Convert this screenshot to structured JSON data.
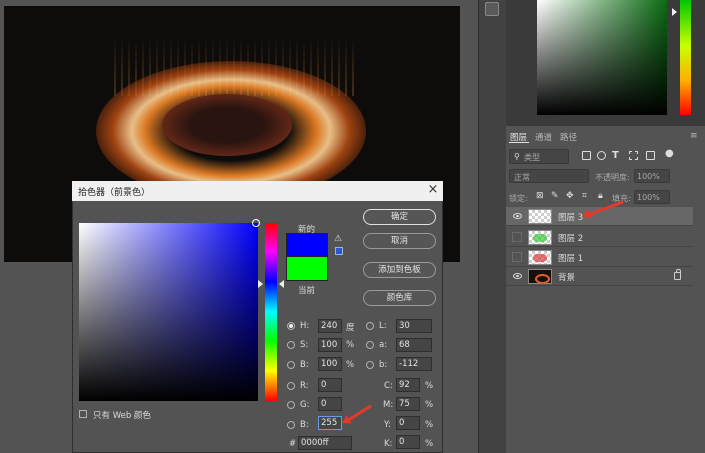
{
  "dialog": {
    "title": "拾色器（前景色）",
    "close": "×",
    "new_label": "新的",
    "current_label": "当前",
    "new_color": "#0000ff",
    "current_color": "#00ff00",
    "buttons": {
      "ok": "确定",
      "cancel": "取消",
      "add_swatch": "添加到色板",
      "libraries": "颜色库"
    },
    "web_only": "只有 Web 颜色",
    "hsb": [
      {
        "label": "H:",
        "value": "240",
        "unit": "度",
        "selected": true
      },
      {
        "label": "S:",
        "value": "100",
        "unit": "%"
      },
      {
        "label": "B:",
        "value": "100",
        "unit": "%"
      }
    ],
    "rgb": [
      {
        "label": "R:",
        "value": "0"
      },
      {
        "label": "G:",
        "value": "0"
      },
      {
        "label": "B:",
        "value": "255"
      }
    ],
    "lab": [
      {
        "label": "L:",
        "value": "30"
      },
      {
        "label": "a:",
        "value": "68"
      },
      {
        "label": "b:",
        "value": "-112"
      }
    ],
    "cmyk": [
      {
        "label": "C:",
        "value": "92",
        "unit": "%"
      },
      {
        "label": "M:",
        "value": "75",
        "unit": "%"
      },
      {
        "label": "Y:",
        "value": "0",
        "unit": "%"
      },
      {
        "label": "K:",
        "value": "0",
        "unit": "%"
      }
    ],
    "hex_label": "#",
    "hex_value": "0000ff"
  },
  "panels": {
    "tabs": [
      "图层",
      "通道",
      "路径"
    ],
    "menu": "≡",
    "filter_kind": "类型",
    "blend_mode": "正常",
    "opacity_label": "不透明度:",
    "opacity_value": "100%",
    "lock_label": "锁定:",
    "fill_label": "填充:",
    "fill_value": "100%"
  },
  "layers": [
    {
      "name": "图层 3",
      "visible": true,
      "selected": true,
      "thumb": "transparent"
    },
    {
      "name": "图层 2",
      "visible": false,
      "selected": false,
      "thumb": "green"
    },
    {
      "name": "图层 1",
      "visible": false,
      "selected": false,
      "thumb": "red"
    },
    {
      "name": "背景",
      "visible": true,
      "selected": false,
      "thumb": "dark",
      "locked": true
    }
  ],
  "colors": {
    "accent_arrow": "#e23a2a",
    "panel_bg": "#535353"
  }
}
